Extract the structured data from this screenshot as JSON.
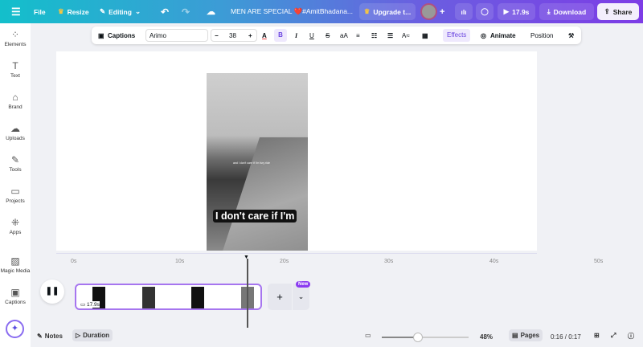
{
  "topbar": {
    "menu_icon": "hamburger-icon",
    "file": "File",
    "resize": "Resize",
    "editing": "Editing",
    "title": "MEN ARE SPECIAL ❤️#AmitBhadana...",
    "upgrade": "Upgrade t...",
    "play_time": "17.9s",
    "download": "Download",
    "share": "Share"
  },
  "sidebar": {
    "items": [
      {
        "label": "Elements",
        "icon": "elements-icon"
      },
      {
        "label": "Text",
        "icon": "text-icon"
      },
      {
        "label": "Brand",
        "icon": "brand-icon"
      },
      {
        "label": "Uploads",
        "icon": "upload-icon"
      },
      {
        "label": "Tools",
        "icon": "tools-icon"
      },
      {
        "label": "Projects",
        "icon": "folder-icon"
      },
      {
        "label": "Apps",
        "icon": "apps-icon"
      },
      {
        "label": "Magic Media",
        "icon": "magic-media-icon"
      },
      {
        "label": "Captions",
        "icon": "captions-icon"
      }
    ]
  },
  "toolbar": {
    "captions": "Captions",
    "font": "Arimo",
    "font_size": "38",
    "bold": "B",
    "italic": "I",
    "underline": "U",
    "strike": "S",
    "case": "aA",
    "effects": "Effects",
    "animate": "Animate",
    "position": "Position"
  },
  "canvas": {
    "caption": "I don't care if I'm",
    "small_caption": "and I don't care if I'm fury ride"
  },
  "timeline": {
    "ticks": [
      "0s",
      "10s",
      "20s",
      "30s",
      "40s",
      "50s"
    ],
    "clip_duration": "17.9s",
    "new_badge": "New"
  },
  "bottom": {
    "notes": "Notes",
    "duration": "Duration",
    "zoom": "48%",
    "zoom_level": 48,
    "pages": "Pages",
    "time": "0:16 / 0:17"
  }
}
